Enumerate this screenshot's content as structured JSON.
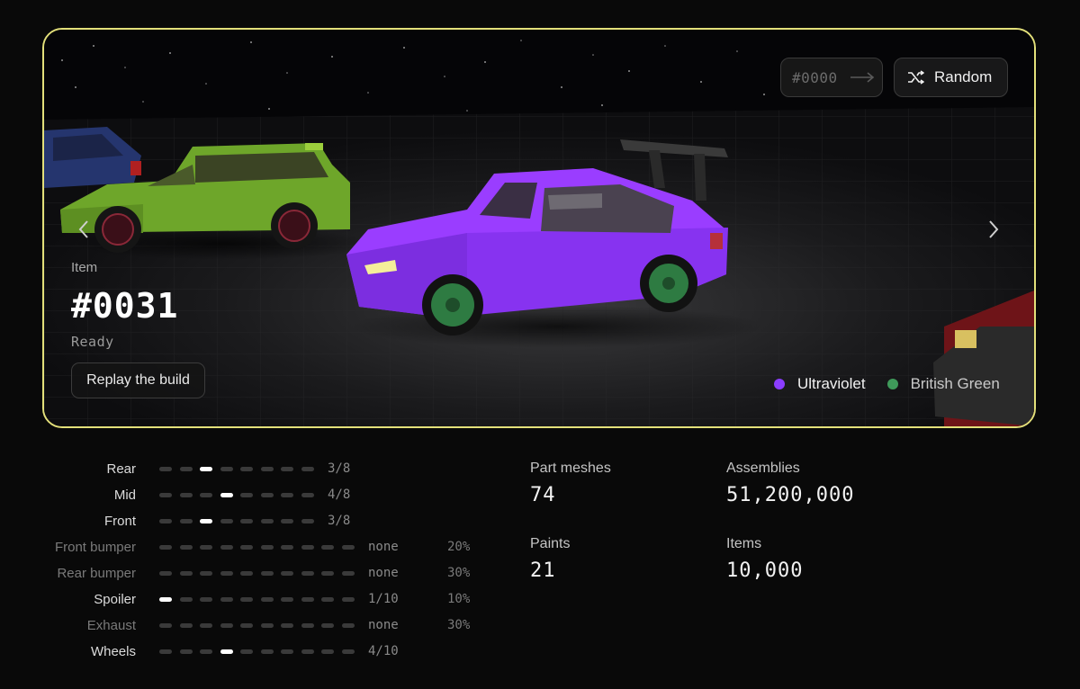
{
  "hero": {
    "seed_placeholder": "#0000",
    "random_label": "Random",
    "item_label": "Item",
    "item_number": "#0031",
    "item_status": "Ready",
    "replay_label": "Replay the build",
    "paints": [
      {
        "name": "Ultraviolet",
        "color": "#8b3dff"
      },
      {
        "name": "British Green",
        "color": "#3f9a5a"
      }
    ]
  },
  "parts": [
    {
      "name": "Rear",
      "count": "3/8",
      "pct": "",
      "total": 8,
      "active": 3
    },
    {
      "name": "Mid",
      "count": "4/8",
      "pct": "",
      "total": 8,
      "active": 4
    },
    {
      "name": "Front",
      "count": "3/8",
      "pct": "",
      "total": 8,
      "active": 3
    },
    {
      "name": "Front bumper",
      "count": "none",
      "pct": "20%",
      "total": 10,
      "active": 0
    },
    {
      "name": "Rear bumper",
      "count": "none",
      "pct": "30%",
      "total": 10,
      "active": 0
    },
    {
      "name": "Spoiler",
      "count": "1/10",
      "pct": "10%",
      "total": 10,
      "active": 1
    },
    {
      "name": "Exhaust",
      "count": "none",
      "pct": "30%",
      "total": 10,
      "active": 0
    },
    {
      "name": "Wheels",
      "count": "4/10",
      "pct": "",
      "total": 10,
      "active": 4
    }
  ],
  "stats": {
    "part_meshes": {
      "label": "Part meshes",
      "value": "74"
    },
    "assemblies": {
      "label": "Assemblies",
      "value": "51,200,000"
    },
    "paints": {
      "label": "Paints",
      "value": "21"
    },
    "items": {
      "label": "Items",
      "value": "10,000"
    }
  }
}
